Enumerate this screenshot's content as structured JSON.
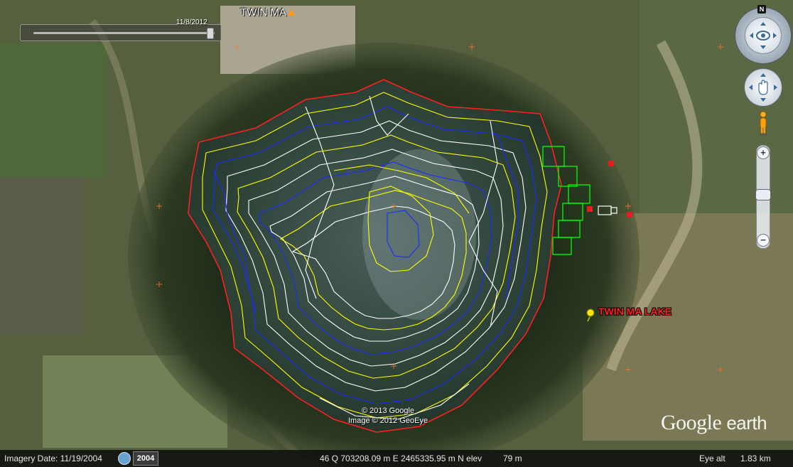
{
  "map": {
    "placemark_top": "TWIN MA",
    "placemark_lake": "TWIN MA LAKE",
    "time_slider_date": "11/8/2012",
    "attribution_line1": "© 2013 Google",
    "attribution_line2": "Image © 2012 GeoEye",
    "logo_google": "Google",
    "logo_earth": "earth"
  },
  "status": {
    "imagery_date": "Imagery Date: 11/19/2004",
    "historical_year": "2004",
    "coordinates": "46 Q 703208.09 m E 2465335.95 m N elev",
    "elevation": "79 m",
    "eye_alt_label": "Eye alt",
    "eye_alt_value": "1.83 km"
  },
  "nav": {
    "north_label": "N",
    "zoom_in": "+",
    "zoom_out": "−"
  },
  "colors": {
    "contour_yellow": "#ffff00",
    "contour_blue": "#1a2cff",
    "contour_white": "#ffffff",
    "lake_boundary": "#ff2020",
    "field_outline": "#00ff00",
    "placemark_label": "#ff2020"
  },
  "icons": [
    "compass-icon",
    "pan-control-icon",
    "pegman-icon",
    "zoom-slider-icon",
    "historical-imagery-icon",
    "pushpin-icon",
    "placemark-icon"
  ]
}
